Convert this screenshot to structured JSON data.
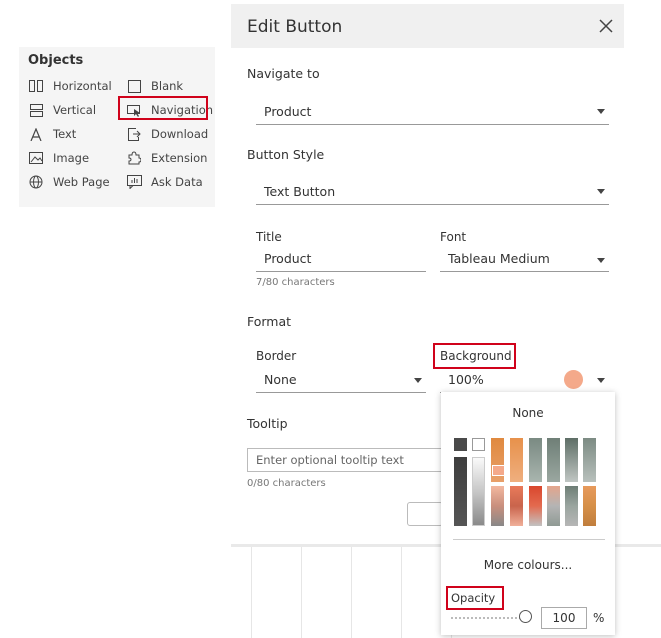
{
  "objects_panel": {
    "title": "Objects",
    "items": [
      {
        "label": "Horizontal",
        "icon": "horizontal-icon"
      },
      {
        "label": "Blank",
        "icon": "blank-icon"
      },
      {
        "label": "Vertical",
        "icon": "vertical-icon"
      },
      {
        "label": "Navigation",
        "icon": "navigation-icon"
      },
      {
        "label": "Text",
        "icon": "text-icon"
      },
      {
        "label": "Download",
        "icon": "download-icon"
      },
      {
        "label": "Image",
        "icon": "image-icon"
      },
      {
        "label": "Extension",
        "icon": "extension-icon"
      },
      {
        "label": "Web Page",
        "icon": "globe-icon"
      },
      {
        "label": "Ask Data",
        "icon": "ask-data-icon"
      }
    ]
  },
  "dialog": {
    "title": "Edit Button",
    "navigate_to": {
      "label": "Navigate to",
      "value": "Product"
    },
    "button_style": {
      "label": "Button Style",
      "value": "Text Button"
    },
    "title_field": {
      "label": "Title",
      "value": "Product",
      "counter": "7/80 characters"
    },
    "font_field": {
      "label": "Font",
      "value": "Tableau Medium"
    },
    "format": {
      "label": "Format",
      "border": {
        "label": "Border",
        "value": "None"
      },
      "background": {
        "label": "Background",
        "value": "100%",
        "swatch_color": "#f4a98a"
      }
    },
    "tooltip": {
      "label": "Tooltip",
      "placeholder": "Enter optional tooltip text",
      "counter": "0/80 characters"
    }
  },
  "color_popup": {
    "none_label": "None",
    "more_colours_label": "More colours...",
    "opacity_label": "Opacity",
    "opacity_value": "100",
    "opacity_unit": "%",
    "opacity_fraction": 1.0
  },
  "colors": {
    "highlight": "#d0021b",
    "accent_orange": "#e8955a"
  }
}
